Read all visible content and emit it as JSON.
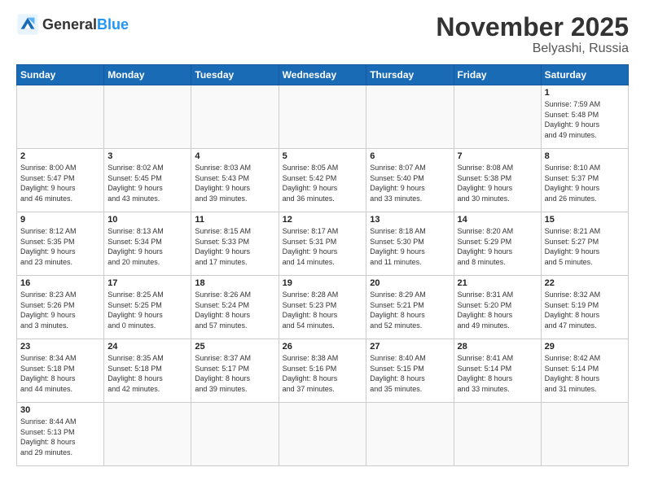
{
  "header": {
    "logo_general": "General",
    "logo_blue": "Blue",
    "month": "November 2025",
    "location": "Belyashi, Russia"
  },
  "weekdays": [
    "Sunday",
    "Monday",
    "Tuesday",
    "Wednesday",
    "Thursday",
    "Friday",
    "Saturday"
  ],
  "weeks": [
    [
      {
        "day": "",
        "info": ""
      },
      {
        "day": "",
        "info": ""
      },
      {
        "day": "",
        "info": ""
      },
      {
        "day": "",
        "info": ""
      },
      {
        "day": "",
        "info": ""
      },
      {
        "day": "",
        "info": ""
      },
      {
        "day": "1",
        "info": "Sunrise: 7:59 AM\nSunset: 5:48 PM\nDaylight: 9 hours\nand 49 minutes."
      }
    ],
    [
      {
        "day": "2",
        "info": "Sunrise: 8:00 AM\nSunset: 5:47 PM\nDaylight: 9 hours\nand 46 minutes."
      },
      {
        "day": "3",
        "info": "Sunrise: 8:02 AM\nSunset: 5:45 PM\nDaylight: 9 hours\nand 43 minutes."
      },
      {
        "day": "4",
        "info": "Sunrise: 8:03 AM\nSunset: 5:43 PM\nDaylight: 9 hours\nand 39 minutes."
      },
      {
        "day": "5",
        "info": "Sunrise: 8:05 AM\nSunset: 5:42 PM\nDaylight: 9 hours\nand 36 minutes."
      },
      {
        "day": "6",
        "info": "Sunrise: 8:07 AM\nSunset: 5:40 PM\nDaylight: 9 hours\nand 33 minutes."
      },
      {
        "day": "7",
        "info": "Sunrise: 8:08 AM\nSunset: 5:38 PM\nDaylight: 9 hours\nand 30 minutes."
      },
      {
        "day": "8",
        "info": "Sunrise: 8:10 AM\nSunset: 5:37 PM\nDaylight: 9 hours\nand 26 minutes."
      }
    ],
    [
      {
        "day": "9",
        "info": "Sunrise: 8:12 AM\nSunset: 5:35 PM\nDaylight: 9 hours\nand 23 minutes."
      },
      {
        "day": "10",
        "info": "Sunrise: 8:13 AM\nSunset: 5:34 PM\nDaylight: 9 hours\nand 20 minutes."
      },
      {
        "day": "11",
        "info": "Sunrise: 8:15 AM\nSunset: 5:33 PM\nDaylight: 9 hours\nand 17 minutes."
      },
      {
        "day": "12",
        "info": "Sunrise: 8:17 AM\nSunset: 5:31 PM\nDaylight: 9 hours\nand 14 minutes."
      },
      {
        "day": "13",
        "info": "Sunrise: 8:18 AM\nSunset: 5:30 PM\nDaylight: 9 hours\nand 11 minutes."
      },
      {
        "day": "14",
        "info": "Sunrise: 8:20 AM\nSunset: 5:29 PM\nDaylight: 9 hours\nand 8 minutes."
      },
      {
        "day": "15",
        "info": "Sunrise: 8:21 AM\nSunset: 5:27 PM\nDaylight: 9 hours\nand 5 minutes."
      }
    ],
    [
      {
        "day": "16",
        "info": "Sunrise: 8:23 AM\nSunset: 5:26 PM\nDaylight: 9 hours\nand 3 minutes."
      },
      {
        "day": "17",
        "info": "Sunrise: 8:25 AM\nSunset: 5:25 PM\nDaylight: 9 hours\nand 0 minutes."
      },
      {
        "day": "18",
        "info": "Sunrise: 8:26 AM\nSunset: 5:24 PM\nDaylight: 8 hours\nand 57 minutes."
      },
      {
        "day": "19",
        "info": "Sunrise: 8:28 AM\nSunset: 5:23 PM\nDaylight: 8 hours\nand 54 minutes."
      },
      {
        "day": "20",
        "info": "Sunrise: 8:29 AM\nSunset: 5:21 PM\nDaylight: 8 hours\nand 52 minutes."
      },
      {
        "day": "21",
        "info": "Sunrise: 8:31 AM\nSunset: 5:20 PM\nDaylight: 8 hours\nand 49 minutes."
      },
      {
        "day": "22",
        "info": "Sunrise: 8:32 AM\nSunset: 5:19 PM\nDaylight: 8 hours\nand 47 minutes."
      }
    ],
    [
      {
        "day": "23",
        "info": "Sunrise: 8:34 AM\nSunset: 5:18 PM\nDaylight: 8 hours\nand 44 minutes."
      },
      {
        "day": "24",
        "info": "Sunrise: 8:35 AM\nSunset: 5:18 PM\nDaylight: 8 hours\nand 42 minutes."
      },
      {
        "day": "25",
        "info": "Sunrise: 8:37 AM\nSunset: 5:17 PM\nDaylight: 8 hours\nand 39 minutes."
      },
      {
        "day": "26",
        "info": "Sunrise: 8:38 AM\nSunset: 5:16 PM\nDaylight: 8 hours\nand 37 minutes."
      },
      {
        "day": "27",
        "info": "Sunrise: 8:40 AM\nSunset: 5:15 PM\nDaylight: 8 hours\nand 35 minutes."
      },
      {
        "day": "28",
        "info": "Sunrise: 8:41 AM\nSunset: 5:14 PM\nDaylight: 8 hours\nand 33 minutes."
      },
      {
        "day": "29",
        "info": "Sunrise: 8:42 AM\nSunset: 5:14 PM\nDaylight: 8 hours\nand 31 minutes."
      }
    ],
    [
      {
        "day": "30",
        "info": "Sunrise: 8:44 AM\nSunset: 5:13 PM\nDaylight: 8 hours\nand 29 minutes."
      },
      {
        "day": "",
        "info": ""
      },
      {
        "day": "",
        "info": ""
      },
      {
        "day": "",
        "info": ""
      },
      {
        "day": "",
        "info": ""
      },
      {
        "day": "",
        "info": ""
      },
      {
        "day": "",
        "info": ""
      }
    ]
  ]
}
